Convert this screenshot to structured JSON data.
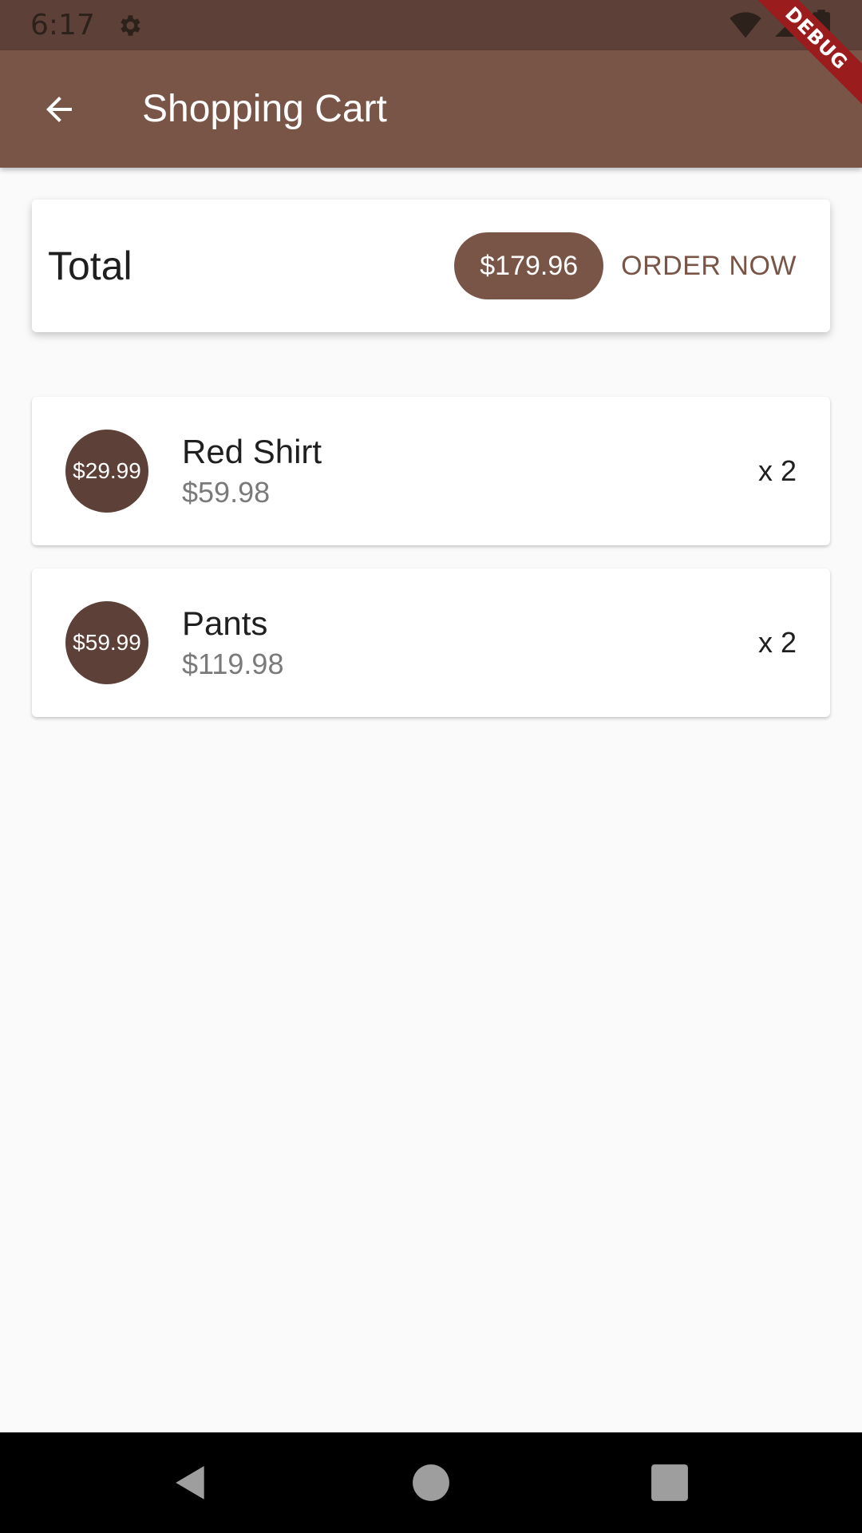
{
  "status_bar": {
    "time": "6:17",
    "icons": [
      "settings-icon",
      "wifi-icon",
      "signal-icon",
      "battery-icon"
    ]
  },
  "debug_banner": "DEBUG",
  "app_bar": {
    "title": "Shopping Cart",
    "back_icon": "arrow-back-icon"
  },
  "total": {
    "label": "Total",
    "amount": "$179.96",
    "order_button": "ORDER NOW"
  },
  "cart_items": [
    {
      "avatar_price": "$29.99",
      "title": "Red Shirt",
      "subtotal": "$59.98",
      "quantity": "x 2"
    },
    {
      "avatar_price": "$59.99",
      "title": "Pants",
      "subtotal": "$119.98",
      "quantity": "x 2"
    }
  ],
  "nav_bar": {
    "icons": [
      "back-triangle-icon",
      "home-circle-icon",
      "recents-square-icon"
    ]
  },
  "colors": {
    "primary": "#795548",
    "primary_dark": "#5d4037",
    "debug_red": "#9b1c1c",
    "background": "#fafafa"
  }
}
